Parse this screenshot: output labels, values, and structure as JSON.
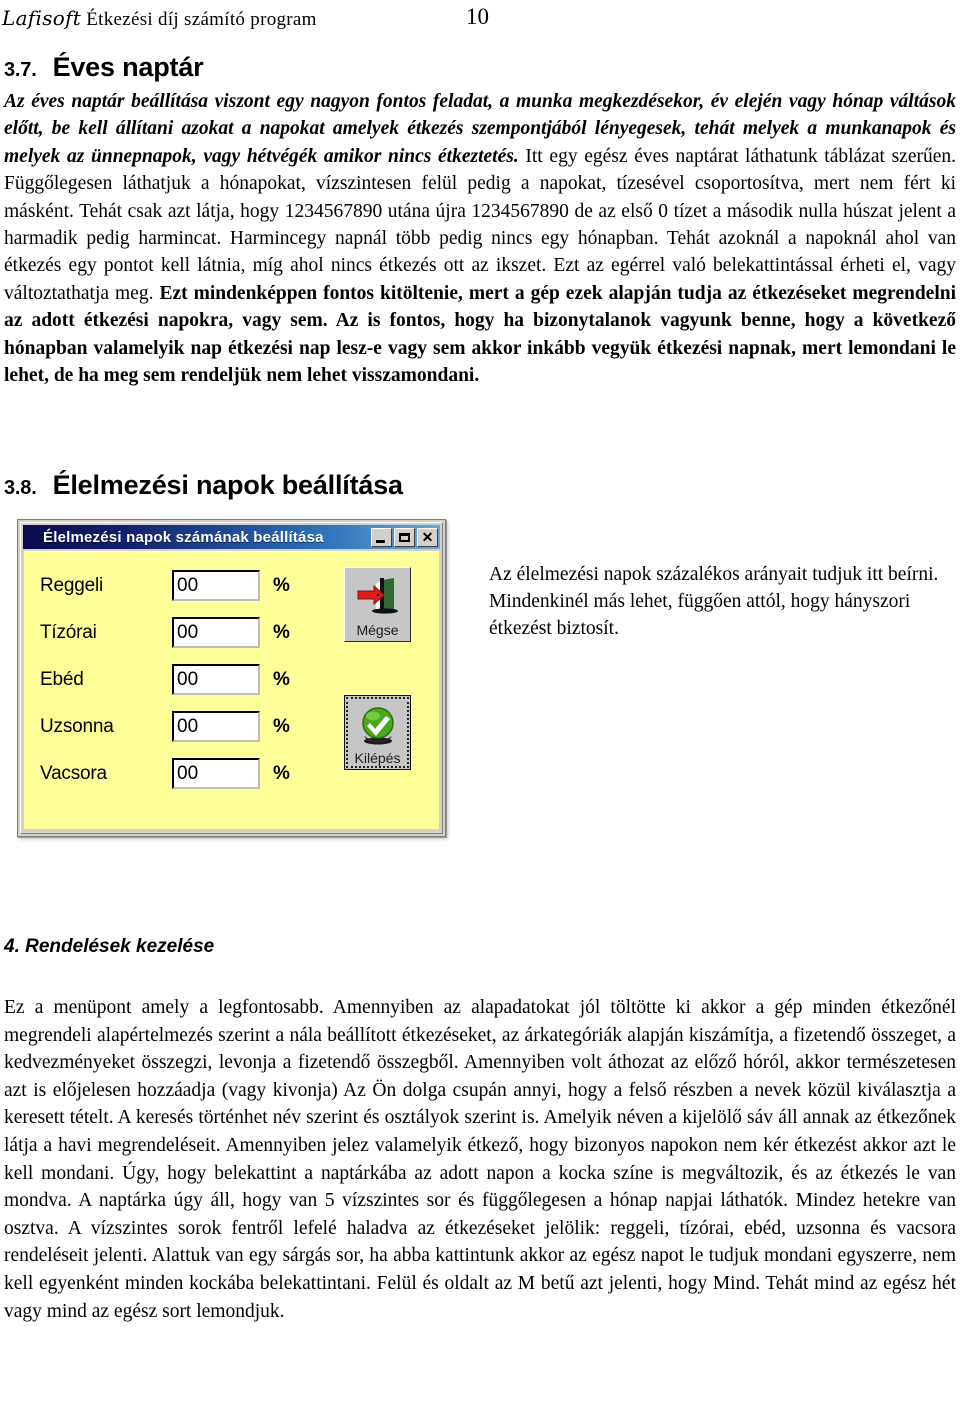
{
  "header": {
    "brand_script": "Lafisoft",
    "brand_rest": " Étkezési díj számító program",
    "page_number": "10"
  },
  "section_37": {
    "number": "3.7.",
    "title": "Éves naptár",
    "paragraph_italic_bold": "Az éves naptár beállítása viszont egy nagyon fontos feladat, a munka megkezdésekor, év elején vagy hónap váltások előtt, be kell állítani azokat a napokat amelyek étkezés szempontjából lényegesek, tehát melyek a munkanapok és melyek az ünnepnapok, vagy hétvégék amikor nincs étkeztetés.",
    "paragraph_roman": " Itt egy egész éves naptárat láthatunk táblázat szerűen. Függőlegesen láthatjuk a hónapokat, vízszintesen felül pedig a napokat, tízesével csoportosítva, mert nem fért ki másként. Tehát csak azt látja, hogy 1234567890 utána újra 1234567890 de az első 0 tízet a második nulla húszat jelent a harmadik pedig harmincat. Harmincegy napnál több pedig nincs egy hónapban. Tehát azoknál a napoknál ahol van étkezés egy pontot kell látnia, míg ahol nincs étkezés ott az ikszet. Ezt az egérrel való belekattintással érheti el, vagy változtathatja meg.",
    "paragraph_bold": " Ezt mindenképpen fontos kitöltenie, mert a gép ezek alapján tudja az étkezéseket megrendelni az adott étkezési napokra, vagy sem. Az is fontos, hogy ha bizonytalanok vagyunk benne, hogy a következő hónapban valamelyik nap étkezési nap lesz-e vagy sem akkor inkább vegyük étkezési napnak, mert lemondani le lehet, de ha meg sem rendeljük nem lehet visszamondani."
  },
  "section_38": {
    "number": "3.8.",
    "title": "Élelmezési napok beállítása",
    "side_note": "Az élelmezési napok százalékos arányait tudjuk itt beírni. Mindenkinél más lehet, függően attól, hogy hányszori étkezést biztosít."
  },
  "dialog": {
    "title": "Élelmezési napok számának beállítása",
    "window_buttons": {
      "minimize": "_",
      "maximize": "□",
      "close": "✕"
    },
    "fields": [
      {
        "label": "Reggeli",
        "value": "00",
        "unit": "%"
      },
      {
        "label": "Tízórai",
        "value": "00",
        "unit": "%"
      },
      {
        "label": "Ebéd",
        "value": "00",
        "unit": "%"
      },
      {
        "label": "Uzsonna",
        "value": "00",
        "unit": "%"
      },
      {
        "label": "Vacsora",
        "value": "00",
        "unit": "%"
      }
    ],
    "buttons": [
      {
        "label": "Mégse",
        "icon": "exit-door-red-arrow-icon"
      },
      {
        "label": "Kilépés",
        "icon": "green-sphere-checkmark-icon"
      }
    ],
    "colors": {
      "client_background": "#ffff99",
      "titlebar_start": "#0a0a4e",
      "titlebar_end": "#66a9d8",
      "button_face": "#c6c6c6"
    }
  },
  "section_4": {
    "heading": "4. Rendelések kezelése",
    "paragraph": "Ez a menüpont amely a legfontosabb. Amennyiben az alapadatokat jól töltötte ki akkor a gép minden étkezőnél megrendeli alapértelmezés szerint a nála beállított étkezéseket, az árkategóriák alapján kiszámítja, a fizetendő összeget, a kedvezményeket összegzi, levonja a fizetendő összegből. Amennyiben volt áthozat az előző hóról, akkor természetesen azt is előjelesen hozzáadja (vagy kivonja) Az Ön dolga csupán annyi, hogy a felső részben a nevek közül kiválasztja a keresett tételt. A keresés történhet név szerint és osztályok szerint is. Amelyik néven a kijelölő sáv áll annak az étkezőnek látja a havi megrendeléseit. Amennyiben jelez valamelyik étkező, hogy bizonyos napokon nem kér étkezést akkor azt le kell mondani. Úgy, hogy belekattint a naptárkába az adott napon a kocka színe is megváltozik, és az étkezés le van mondva. A naptárka úgy áll, hogy van 5 vízszintes sor és függőlegesen a hónap napjai láthatók. Mindez hetekre van osztva. A vízszintes sorok fentről lefelé haladva az étkezéseket jelölik: reggeli, tízórai, ebéd, uzsonna és vacsora rendeléseit jelenti. Alattuk van egy sárgás sor, ha abba kattintunk akkor az egész napot le tudjuk mondani egyszerre, nem kell egyenként minden kockába belekattintani. Felül és oldalt az M betű azt jelenti, hogy Mind. Tehát mind az egész hét vagy mind az egész sort lemondjuk."
  }
}
